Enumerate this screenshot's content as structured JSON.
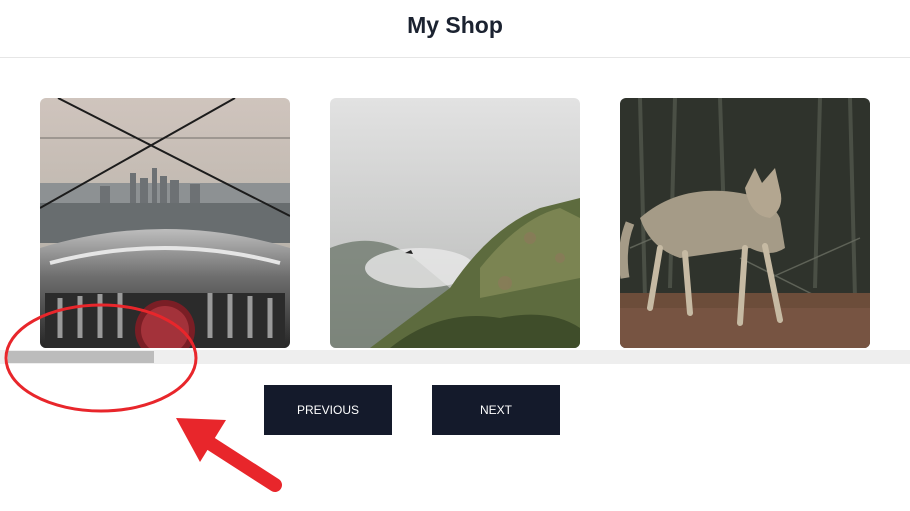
{
  "header": {
    "title": "My Shop"
  },
  "gallery": {
    "items": [
      {
        "name": "city-viewer-image",
        "alt": "City skyline seen behind a coin-operated viewer"
      },
      {
        "name": "foggy-cliff-image",
        "alt": "Mossy cliff over fog"
      },
      {
        "name": "coyote-image",
        "alt": "Coyote standing in a forest"
      }
    ]
  },
  "scrollbar": {
    "thumb_fraction": 0.16,
    "position_fraction": 0.0
  },
  "buttons": {
    "previous_label": "PREVIOUS",
    "next_label": "NEXT"
  },
  "colors": {
    "header_text": "#1b2230",
    "button_bg": "#141a2b",
    "button_text": "#ffffff",
    "annotation": "#e8262b",
    "scroll_track": "#eeeeee",
    "scroll_thumb": "#bcbcbc"
  }
}
